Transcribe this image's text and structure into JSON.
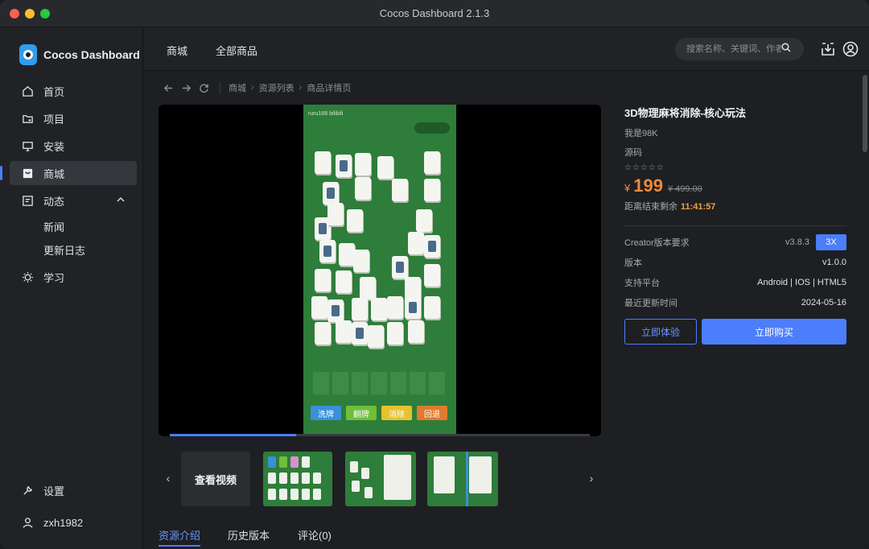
{
  "window": {
    "title": "Cocos Dashboard 2.1.3"
  },
  "sidebar": {
    "logo_text": "Cocos Dashboard",
    "items": [
      {
        "label": "首页",
        "icon": "home-icon"
      },
      {
        "label": "项目",
        "icon": "folder-icon"
      },
      {
        "label": "安装",
        "icon": "monitor-icon"
      },
      {
        "label": "商城",
        "icon": "store-icon",
        "active": true
      },
      {
        "label": "动态",
        "icon": "news-icon",
        "expanded": true
      }
    ],
    "subitems": [
      "新闻",
      "更新日志"
    ],
    "learn": {
      "label": "学习",
      "icon": "sun-icon"
    },
    "settings": {
      "label": "设置",
      "icon": "wrench-icon"
    },
    "user": {
      "label": "zxh1982",
      "icon": "user-icon"
    }
  },
  "header": {
    "tabs": [
      "商城",
      "全部商品"
    ],
    "search_placeholder": "搜索名称、关键词、作者"
  },
  "breadcrumb": [
    "商城",
    "资源列表",
    "商品详情页"
  ],
  "player": {
    "watermark": "ruru168 bilibili",
    "game_buttons": [
      "洗牌",
      "翻牌",
      "消除",
      "回退"
    ],
    "progress": 0.3
  },
  "gallery": {
    "video_label": "查看视频"
  },
  "tabs": [
    "资源介绍",
    "历史版本",
    "评论(0)"
  ],
  "product": {
    "title": "3D物理麻将消除-核心玩法",
    "author": "我是98K",
    "type": "源码",
    "stars": "☆☆☆☆☆",
    "currency": "¥",
    "price": "199",
    "old_price": "¥ 499.00",
    "countdown_label": "距离结束剩余",
    "countdown": "11:41:57",
    "specs": [
      {
        "key": "Creator版本要求",
        "value": "v3.8.3"
      },
      {
        "key": "版本",
        "value": "v1.0.0"
      },
      {
        "key": "支持平台",
        "value": "Android | IOS | HTML5"
      },
      {
        "key": "最近更新时间",
        "value": "2024-05-16"
      }
    ],
    "version_badge": "3X",
    "try_label": "立即体验",
    "buy_label": "立即购买"
  },
  "colors": {
    "accent": "#4c7dfa",
    "price": "#f08a3c",
    "countdown": "#f0a23c"
  }
}
